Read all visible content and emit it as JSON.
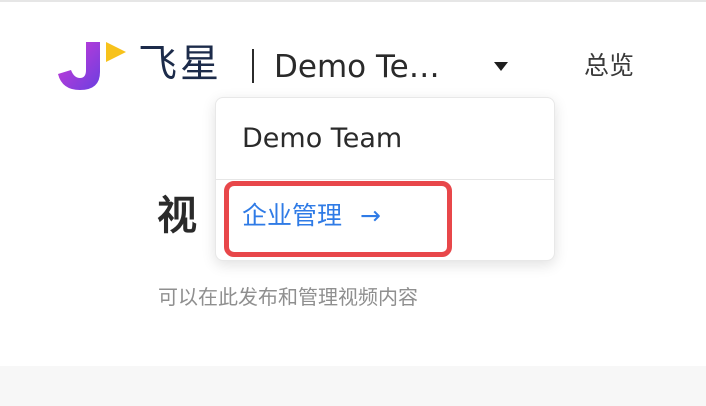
{
  "header": {
    "brand_name": "飞星",
    "team_selector_label": "Demo Te…",
    "nav_overview": "总览"
  },
  "page": {
    "heading_visible": "视",
    "subtitle": "可以在此发布和管理视频内容"
  },
  "dropdown": {
    "team_item_label": "Demo Team",
    "manage_item_label": "企业管理",
    "manage_item_arrow": "→"
  },
  "colors": {
    "brand_text": "#1c2b4a",
    "link_blue": "#2f7be6",
    "highlight_red": "#e8474a",
    "logo_purple": "#7b3fe4",
    "logo_magenta": "#d23ad6",
    "logo_yellow": "#f7c21b"
  },
  "icons": {
    "logo": "jx-brand-logo",
    "caret": "caret-down-icon",
    "arrow": "arrow-right-icon"
  }
}
